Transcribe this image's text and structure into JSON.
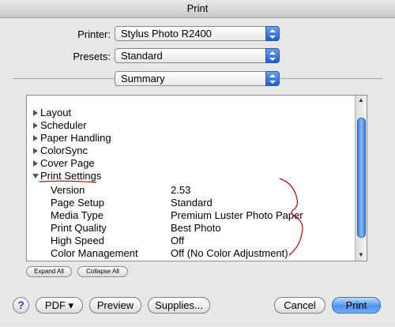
{
  "window": {
    "title": "Print"
  },
  "printer": {
    "label": "Printer:",
    "value": "Stylus Photo R2400"
  },
  "presets": {
    "label": "Presets:",
    "value": "Standard"
  },
  "panel_select": {
    "value": "Summary"
  },
  "outline": {
    "collapsed": [
      "Layout",
      "Scheduler",
      "Paper Handling",
      "ColorSync",
      "Cover Page"
    ],
    "expanded": {
      "label": "Print Settings",
      "rows": [
        {
          "key": "Version",
          "value": "2.53"
        },
        {
          "key": "Page Setup",
          "value": "Standard"
        },
        {
          "key": "Media Type",
          "value": "Premium Luster Photo Paper"
        },
        {
          "key": "Print Quality",
          "value": "Best Photo"
        },
        {
          "key": "High Speed",
          "value": "Off"
        },
        {
          "key": "Color Management",
          "value": "Off (No Color Adjustment)"
        }
      ]
    }
  },
  "buttons": {
    "expand_all": "Expand All",
    "collapse_all": "Collapse All",
    "help": "?",
    "pdf": "PDF ▾",
    "preview": "Preview",
    "supplies": "Supplies...",
    "cancel": "Cancel",
    "print": "Print"
  },
  "colors": {
    "accent_blue": "#1f5fd0",
    "annotation_red": "#c00000"
  },
  "icons": {
    "popup_arrows": "up-down-arrows-icon",
    "disclosure_closed": "triangle-right-icon",
    "disclosure_open": "triangle-down-icon"
  }
}
